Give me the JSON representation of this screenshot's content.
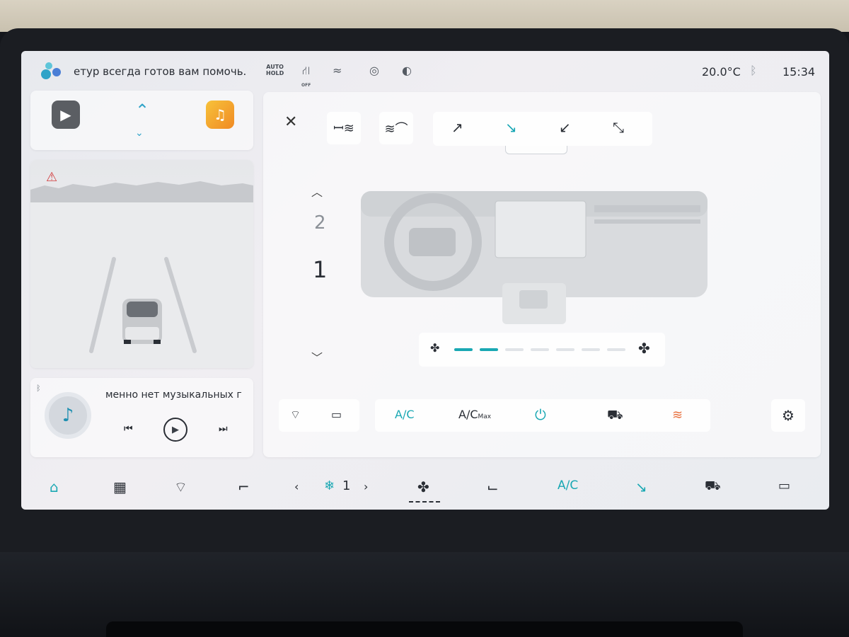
{
  "status": {
    "assistant_text": "етур всегда готов вам помочь.",
    "autohold_label": "AUTO\nHOLD",
    "off_label": "OFF",
    "temperature": "20.0°C",
    "time": "15:34"
  },
  "player": {
    "track_text": "менно нет музыкальных г"
  },
  "climate": {
    "level_upper": "2",
    "level_current": "1",
    "fan_segments_total": 7,
    "fan_level": 2,
    "ac_label": "A/C",
    "acmax_label": "A/C",
    "acmax_sub": "Max"
  },
  "dock": {
    "temp_value": "1",
    "ac_label": "A/C"
  },
  "colors": {
    "accent": "#1aa8b3",
    "accent_blue": "#2fa3c8",
    "warning": "#d23a3a",
    "heat": "#e8713f"
  }
}
